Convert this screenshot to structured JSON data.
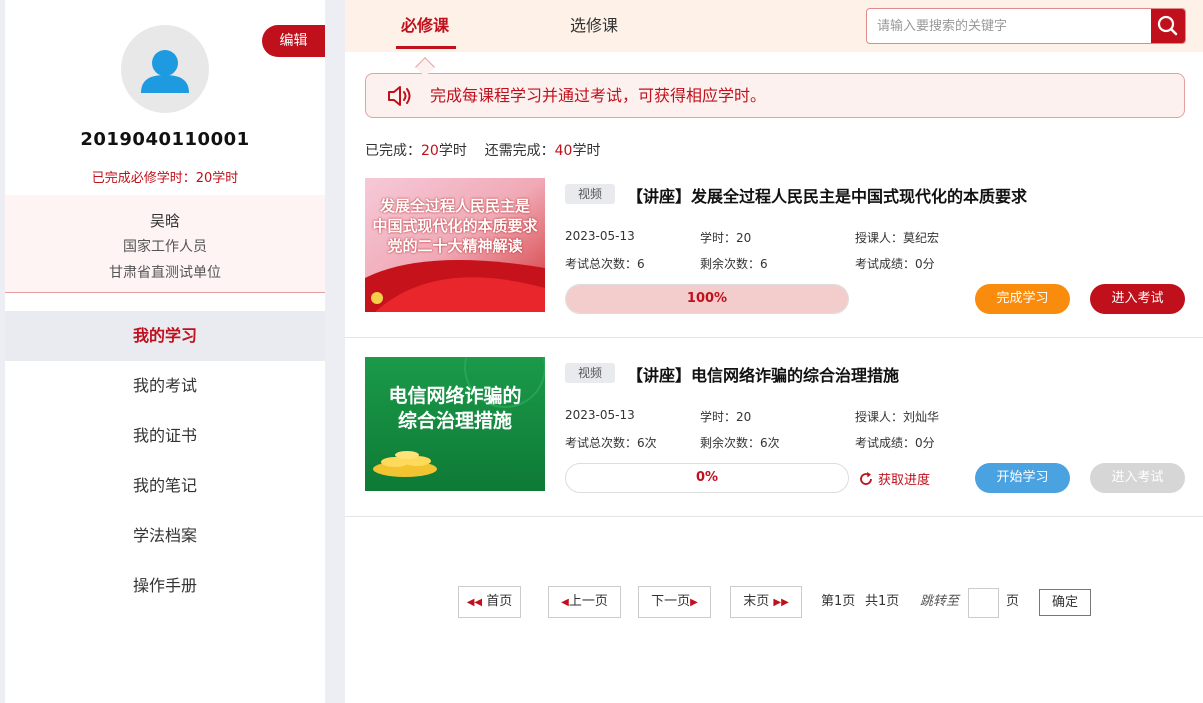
{
  "sidebar": {
    "edit_label": "编辑",
    "user_id": "2019040110001",
    "credit_label": "已完成必修学时：20学时",
    "user": {
      "name": "吴晗",
      "role": "国家工作人员",
      "unit": "甘肃省直测试单位"
    },
    "menu": [
      {
        "label": "我的学习",
        "active": true
      },
      {
        "label": "我的考试"
      },
      {
        "label": "我的证书"
      },
      {
        "label": "我的笔记"
      },
      {
        "label": "学法档案"
      },
      {
        "label": "操作手册"
      }
    ]
  },
  "tabs": [
    {
      "label": "必修课",
      "active": true
    },
    {
      "label": "选修课"
    }
  ],
  "search": {
    "placeholder": "请输入要搜索的关键字"
  },
  "notice": "完成每课程学习并通过考试，可获得相应学时。",
  "summary": {
    "completed_label": "已完成：",
    "completed_value": "20",
    "unit": "学时",
    "required_label": "还需完成：",
    "required_value": "40"
  },
  "courses": [
    {
      "type": "视频",
      "title": "【讲座】发展全过程人民民主是中国式现代化的本质要求",
      "thumb_text": [
        "发展全过程人民民主是",
        "中国式现代化的本质要求",
        "党的二十大精神解读"
      ],
      "date": "2023-05-13",
      "hours": "学时：20",
      "teacher": "授课人：莫纪宏",
      "exam_total": "考试总次数：6",
      "exam_left": "剩余次数：6",
      "score": "考试成绩：0分",
      "progress": 100,
      "progress_label": "100%",
      "primary_action": "完成学习",
      "exam_action": "进入考试"
    },
    {
      "type": "视频",
      "title": "【讲座】电信网络诈骗的综合治理措施",
      "thumb_text": [
        "电信网络诈骗的",
        "综合治理措施"
      ],
      "date": "2023-05-13",
      "hours": "学时：20",
      "teacher": "授课人：刘灿华",
      "exam_total": "考试总次数：6次",
      "exam_left": "剩余次数：6次",
      "score": "考试成绩：0分",
      "progress": 0,
      "progress_label": "0%",
      "refresh_label": "获取进度",
      "primary_action": "开始学习",
      "exam_action": "进入考试"
    }
  ],
  "pagination": {
    "first": "首页",
    "prev": "上一页",
    "next": "下一页",
    "last": "末页",
    "page_info": "第1页",
    "total_info": "共1页",
    "jump_label": "跳转至",
    "page_unit": "页",
    "confirm": "确定"
  },
  "colors": {
    "primary_red": "#c0101c",
    "orange": "#f98b0d",
    "blue": "#4aa3e0",
    "disabled": "#d6d6d6"
  }
}
